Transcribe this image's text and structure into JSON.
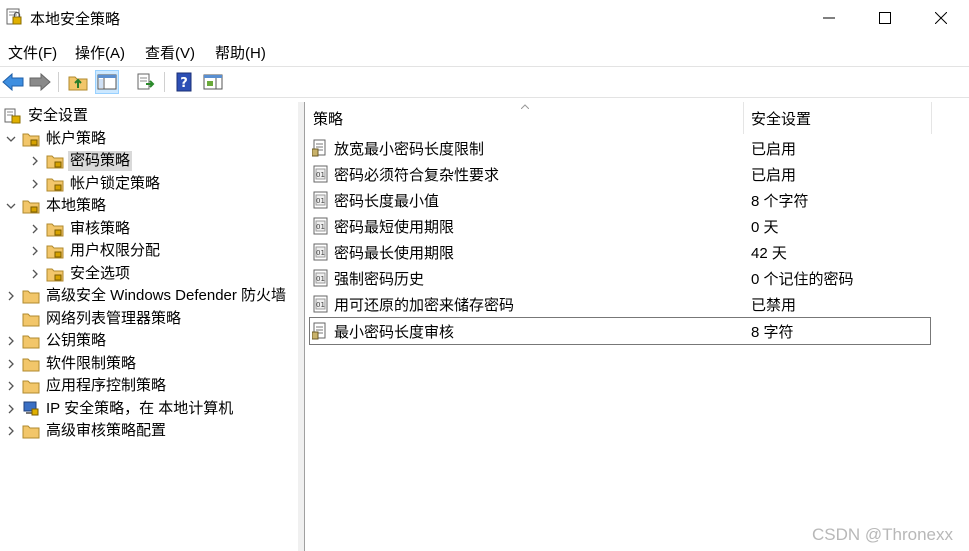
{
  "window": {
    "title": "本地安全策略"
  },
  "menu": [
    "文件(F)",
    "操作(A)",
    "查看(V)",
    "帮助(H)"
  ],
  "toolbar_icons": [
    "back-arrow-icon",
    "forward-arrow-icon",
    "up-folder-icon",
    "show-hide-tree-icon",
    "export-list-icon",
    "help-icon",
    "console-view-icon"
  ],
  "tree": {
    "root": "安全设置",
    "account_policies": "帐户策略",
    "password_policy": "密码策略",
    "lockout_policy": "帐户锁定策略",
    "local_policies": "本地策略",
    "audit_policy": "审核策略",
    "user_rights": "用户权限分配",
    "security_options": "安全选项",
    "firewall": "高级安全 Windows Defender 防火墙",
    "network_list": "网络列表管理器策略",
    "public_key": "公钥策略",
    "software_restriction": "软件限制策略",
    "app_control": "应用程序控制策略",
    "ipsec": "IP 安全策略，在 本地计算机",
    "advanced_audit": "高级审核策略配置"
  },
  "columns": {
    "policy": "策略",
    "setting": "安全设置"
  },
  "policies": [
    {
      "name": "放宽最小密码长度限制",
      "value": "已启用"
    },
    {
      "name": "密码必须符合复杂性要求",
      "value": "已启用"
    },
    {
      "name": "密码长度最小值",
      "value": "8 个字符"
    },
    {
      "name": "密码最短使用期限",
      "value": "0 天"
    },
    {
      "name": "密码最长使用期限",
      "value": "42 天"
    },
    {
      "name": "强制密码历史",
      "value": "0 个记住的密码"
    },
    {
      "name": "用可还原的加密来储存密码",
      "value": "已禁用"
    },
    {
      "name": "最小密码长度审核",
      "value": "8 字符"
    }
  ],
  "watermark": "CSDN @Thronexx",
  "colors": {
    "selection": "#d9d9d9",
    "toolbar_selected": "#cce8ff",
    "folder": "#f2c66a"
  }
}
